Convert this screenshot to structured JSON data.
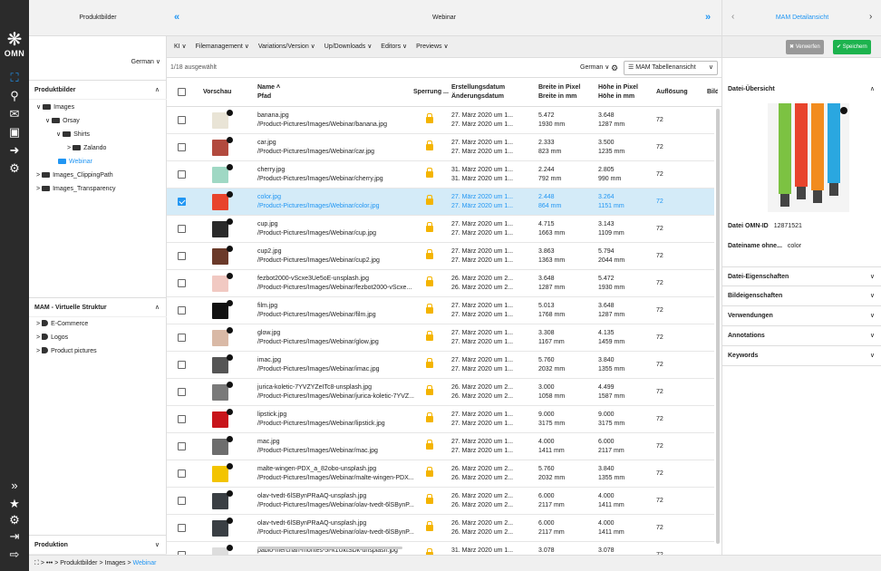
{
  "rail": {
    "logo": "OMN",
    "top_icons": [
      "hierarchy-icon",
      "search-icon",
      "mail-icon",
      "box-icon",
      "arrow-right-icon",
      "gears-icon"
    ],
    "bottom_icons": [
      "double-chevron-right-icon",
      "star-icon",
      "gear-icon",
      "logout-icon",
      "exit-icon"
    ]
  },
  "left": {
    "header": "Produktbilder",
    "language": "German ∨",
    "section1_title": "Produktbilder",
    "tree": [
      {
        "label": "Images",
        "chev": "∨"
      },
      {
        "label": "Orsay",
        "chev": "∨"
      },
      {
        "label": "Shirts",
        "chev": "∨"
      },
      {
        "label": "Zalando",
        "chev": ">"
      },
      {
        "label": "Webinar",
        "chev": ""
      },
      {
        "label": "Images_ClippingPath",
        "chev": ">"
      },
      {
        "label": "Images_Transparency",
        "chev": ">"
      }
    ],
    "section2_title": "MAM - Virtuelle Struktur",
    "vtree": [
      {
        "label": "E-Commerce"
      },
      {
        "label": "Logos"
      },
      {
        "label": "Product pictures"
      }
    ],
    "section3_title": "Produktion"
  },
  "center": {
    "header": "Webinar",
    "collapse_left": "«",
    "expand_right": "»",
    "toolbar": [
      "KI ∨",
      "Filemanagement ∨",
      "Variations/Version ∨",
      "Up/Downloads ∨",
      "Editors ∨",
      "Previews ∨"
    ],
    "selected_count": "1/18 ausgewählt",
    "language": "German ∨",
    "view_select": "MAM Tabellenansicht",
    "columns": {
      "preview": "Vorschau",
      "name": "Name",
      "path": "Pfad",
      "lock": "Sperrung ...",
      "created": "Erstellungsdatum",
      "modified": "Änderungsdatum",
      "width_px": "Breite in Pixel",
      "width_mm": "Breite in mm",
      "height_px": "Höhe in Pixel",
      "height_mm": "Höhe in mm",
      "resolution": "Auflösung",
      "more": "Bild"
    },
    "rows": [
      {
        "name": "banana.jpg",
        "path": "/Product-Pictures/Images/Webinar/banana.jpg",
        "created": "27. März 2020 um 1...",
        "modified": "27. März 2020 um 1...",
        "wpx": "5.472",
        "wmm": "1930 mm",
        "hpx": "3.648",
        "hmm": "1287 mm",
        "res": "72",
        "color": "#e9e4d6",
        "selected": false
      },
      {
        "name": "car.jpg",
        "path": "/Product-Pictures/Images/Webinar/car.jpg",
        "created": "27. März 2020 um 1...",
        "modified": "27. März 2020 um 1...",
        "wpx": "2.333",
        "wmm": "823 mm",
        "hpx": "3.500",
        "hmm": "1235 mm",
        "res": "72",
        "color": "#b24a3e",
        "selected": false
      },
      {
        "name": "cherry.jpg",
        "path": "/Product-Pictures/Images/Webinar/cherry.jpg",
        "created": "31. März 2020 um 1...",
        "modified": "31. März 2020 um 1...",
        "wpx": "2.244",
        "wmm": "792 mm",
        "hpx": "2.805",
        "hmm": "990 mm",
        "res": "72",
        "color": "#9fd8c4",
        "selected": false
      },
      {
        "name": "color.jpg",
        "path": "/Product-Pictures/Images/Webinar/color.jpg",
        "created": "27. März 2020 um 1...",
        "modified": "27. März 2020 um 1...",
        "wpx": "2.448",
        "wmm": "864 mm",
        "hpx": "3.264",
        "hmm": "1151 mm",
        "res": "72",
        "color": "#e8442c",
        "selected": true
      },
      {
        "name": "cup.jpg",
        "path": "/Product-Pictures/Images/Webinar/cup.jpg",
        "created": "27. März 2020 um 1...",
        "modified": "27. März 2020 um 1...",
        "wpx": "4.715",
        "wmm": "1663 mm",
        "hpx": "3.143",
        "hmm": "1109 mm",
        "res": "72",
        "color": "#2a2a2a",
        "selected": false
      },
      {
        "name": "cup2.jpg",
        "path": "/Product-Pictures/Images/Webinar/cup2.jpg",
        "created": "27. März 2020 um 1...",
        "modified": "27. März 2020 um 1...",
        "wpx": "3.863",
        "wmm": "1363 mm",
        "hpx": "5.794",
        "hmm": "2044 mm",
        "res": "72",
        "color": "#6b3a2a",
        "selected": false
      },
      {
        "name": "fezbot2000-vScxe3Ue5oE-unsplash.jpg",
        "path": "/Product-Pictures/Images/Webinar/fezbot2000-vScxe...",
        "created": "26. März 2020 um 2...",
        "modified": "26. März 2020 um 2...",
        "wpx": "3.648",
        "wmm": "1287 mm",
        "hpx": "5.472",
        "hmm": "1930 mm",
        "res": "72",
        "color": "#f1c9c2",
        "selected": false
      },
      {
        "name": "film.jpg",
        "path": "/Product-Pictures/Images/Webinar/film.jpg",
        "created": "27. März 2020 um 1...",
        "modified": "27. März 2020 um 1...",
        "wpx": "5.013",
        "wmm": "1768 mm",
        "hpx": "3.648",
        "hmm": "1287 mm",
        "res": "72",
        "color": "#111111",
        "selected": false
      },
      {
        "name": "glow.jpg",
        "path": "/Product-Pictures/Images/Webinar/glow.jpg",
        "created": "27. März 2020 um 1...",
        "modified": "27. März 2020 um 1...",
        "wpx": "3.308",
        "wmm": "1167 mm",
        "hpx": "4.135",
        "hmm": "1459 mm",
        "res": "72",
        "color": "#d9b9a6",
        "selected": false
      },
      {
        "name": "imac.jpg",
        "path": "/Product-Pictures/Images/Webinar/imac.jpg",
        "created": "27. März 2020 um 1...",
        "modified": "27. März 2020 um 1...",
        "wpx": "5.760",
        "wmm": "2032 mm",
        "hpx": "3.840",
        "hmm": "1355 mm",
        "res": "72",
        "color": "#555555",
        "selected": false
      },
      {
        "name": "jurica-koletic-7YVZYZeITc8-unsplash.jpg",
        "path": "/Product-Pictures/Images/Webinar/jurica-koletic-7YVZ...",
        "created": "26. März 2020 um 2...",
        "modified": "26. März 2020 um 2...",
        "wpx": "3.000",
        "wmm": "1058 mm",
        "hpx": "4.499",
        "hmm": "1587 mm",
        "res": "72",
        "color": "#7a7a7a",
        "selected": false
      },
      {
        "name": "lipstick.jpg",
        "path": "/Product-Pictures/Images/Webinar/lipstick.jpg",
        "created": "27. März 2020 um 1...",
        "modified": "27. März 2020 um 1...",
        "wpx": "9.000",
        "wmm": "3175 mm",
        "hpx": "9.000",
        "hmm": "3175 mm",
        "res": "72",
        "color": "#c8151b",
        "selected": false
      },
      {
        "name": "mac.jpg",
        "path": "/Product-Pictures/Images/Webinar/mac.jpg",
        "created": "27. März 2020 um 1...",
        "modified": "27. März 2020 um 1...",
        "wpx": "4.000",
        "wmm": "1411 mm",
        "hpx": "6.000",
        "hmm": "2117 mm",
        "res": "72",
        "color": "#6d6d6d",
        "selected": false
      },
      {
        "name": "malte-wingen-PDX_a_82obo-unsplash.jpg",
        "path": "/Product-Pictures/Images/Webinar/malte-wingen-PDX...",
        "created": "26. März 2020 um 2...",
        "modified": "26. März 2020 um 2...",
        "wpx": "5.760",
        "wmm": "2032 mm",
        "hpx": "3.840",
        "hmm": "1355 mm",
        "res": "72",
        "color": "#f3c400",
        "selected": false
      },
      {
        "name": "olav-tvedt-6lSBynPRaAQ-unsplash.jpg",
        "path": "/Product-Pictures/Images/Webinar/olav-tvedt-6lSBynP...",
        "created": "26. März 2020 um 2...",
        "modified": "26. März 2020 um 2...",
        "wpx": "6.000",
        "wmm": "2117 mm",
        "hpx": "4.000",
        "hmm": "1411 mm",
        "res": "72",
        "color": "#3a3f44",
        "selected": false
      },
      {
        "name": "olav-tvedt-6lSBynPRaAQ-unsplash.jpg",
        "path": "/Product-Pictures/Images/Webinar/olav-tvedt-6lSBynP...",
        "created": "26. März 2020 um 2...",
        "modified": "26. März 2020 um 2...",
        "wpx": "6.000",
        "wmm": "2117 mm",
        "hpx": "4.000",
        "hmm": "1411 mm",
        "res": "72",
        "color": "#3a3f44",
        "selected": false
      },
      {
        "name": "pablo-merchan-montes-5l-k1UktSDk-unsplash.jpg",
        "path": "",
        "created": "31. März 2020 um 1...",
        "modified": "",
        "wpx": "3.078",
        "wmm": "",
        "hpx": "3.078",
        "hmm": "",
        "res": "72",
        "color": "#dddddd",
        "selected": false
      }
    ]
  },
  "right": {
    "header": "MAM Detailansicht",
    "prev": "‹",
    "next": "›",
    "discard": "Verwerfen",
    "save": "Speichern",
    "overview_title": "Datei-Übersicht",
    "omn_id_label": "Datei OMN-ID",
    "omn_id_value": "12871521",
    "filename_label": "Dateiname ohne...",
    "filename_value": "color",
    "sections": [
      "Datei-Eigenschaften",
      "Bildeigenschaften",
      "Verwendungen",
      "Annotations",
      "Keywords"
    ],
    "paint_colors": [
      "#7cc242",
      "#e8442c",
      "#f28c1e",
      "#2aa7e0"
    ]
  },
  "breadcrumb": {
    "dots": "•••",
    "items": [
      "Produktbilder",
      "Images"
    ],
    "current": "Webinar",
    "sep": ">"
  },
  "glyphs": {
    "chev_up": "∧",
    "chev_down": "∨",
    "sort_up": "˄",
    "list": "☰",
    "gear": "⚙"
  }
}
